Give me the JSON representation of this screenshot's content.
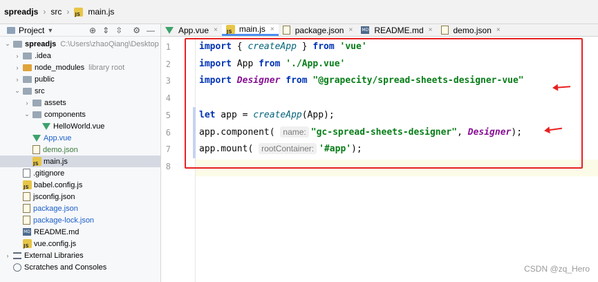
{
  "breadcrumb": {
    "project": "spreadjs",
    "folder": "src",
    "file": "main.js"
  },
  "project_panel": {
    "title": "Project",
    "tree": [
      {
        "label": "spreadjs",
        "path_hint": "C:\\Users\\zhaoQiang\\Desktop",
        "type": "folder",
        "expanded": true,
        "indent": 0
      },
      {
        "label": ".idea",
        "type": "folder",
        "expanded": false,
        "indent": 1
      },
      {
        "label": "node_modules",
        "suffix": "library root",
        "type": "folder-orange",
        "expanded": false,
        "indent": 1
      },
      {
        "label": "public",
        "type": "folder",
        "expanded": false,
        "indent": 1
      },
      {
        "label": "src",
        "type": "folder",
        "expanded": true,
        "indent": 1
      },
      {
        "label": "assets",
        "type": "folder",
        "expanded": false,
        "indent": 2
      },
      {
        "label": "components",
        "type": "folder",
        "expanded": true,
        "indent": 2
      },
      {
        "label": "HelloWorld.vue",
        "type": "vue",
        "indent": 3
      },
      {
        "label": "App.vue",
        "type": "vue",
        "color": "blue",
        "indent": 2
      },
      {
        "label": "demo.json",
        "type": "json",
        "color": "green",
        "indent": 2
      },
      {
        "label": "main.js",
        "type": "js",
        "indent": 2,
        "selected": true
      },
      {
        "label": ".gitignore",
        "type": "file",
        "indent": 1
      },
      {
        "label": "babel.config.js",
        "type": "js",
        "indent": 1
      },
      {
        "label": "jsconfig.json",
        "type": "json",
        "indent": 1
      },
      {
        "label": "package.json",
        "type": "json",
        "color": "blue",
        "indent": 1
      },
      {
        "label": "package-lock.json",
        "type": "json",
        "color": "blue",
        "indent": 1
      },
      {
        "label": "README.md",
        "type": "md",
        "indent": 1
      },
      {
        "label": "vue.config.js",
        "type": "js",
        "indent": 1
      },
      {
        "label": "External Libraries",
        "type": "bars",
        "expanded": false,
        "indent": 0
      },
      {
        "label": "Scratches and Consoles",
        "type": "scratch",
        "indent": 0
      }
    ]
  },
  "tabs": [
    {
      "label": "App.vue",
      "icon": "vue-icon",
      "active": false
    },
    {
      "label": "main.js",
      "icon": "js-icon",
      "active": true
    },
    {
      "label": "package.json",
      "icon": "json-icon",
      "active": false
    },
    {
      "label": "README.md",
      "icon": "md-icon",
      "active": false
    },
    {
      "label": "demo.json",
      "icon": "json-icon",
      "active": false
    }
  ],
  "editor": {
    "line_numbers": [
      "1",
      "2",
      "3",
      "4",
      "5",
      "6",
      "7",
      "8"
    ],
    "lines": [
      [
        {
          "t": "import",
          "c": "kw"
        },
        {
          "t": " { "
        },
        {
          "t": "createApp",
          "c": "fn"
        },
        {
          "t": " } "
        },
        {
          "t": "from",
          "c": "kw"
        },
        {
          "t": " "
        },
        {
          "t": "'vue'",
          "c": "str"
        }
      ],
      [
        {
          "t": "import",
          "c": "kw"
        },
        {
          "t": " App "
        },
        {
          "t": "from",
          "c": "kw"
        },
        {
          "t": " "
        },
        {
          "t": "'./App.vue'",
          "c": "str"
        }
      ],
      [
        {
          "t": "import",
          "c": "kw"
        },
        {
          "t": " "
        },
        {
          "t": "Designer",
          "c": "cls"
        },
        {
          "t": " "
        },
        {
          "t": "from",
          "c": "kw"
        },
        {
          "t": " "
        },
        {
          "t": "\"@grapecity/spread-sheets-designer-vue\"",
          "c": "str"
        }
      ],
      [],
      [
        {
          "t": "let",
          "c": "kw"
        },
        {
          "t": " app = "
        },
        {
          "t": "createApp",
          "c": "fn"
        },
        {
          "t": "(App);"
        }
      ],
      [
        {
          "t": "app.component( "
        },
        {
          "t": "name:",
          "c": "hint"
        },
        {
          "t": "\"gc-spread-sheets-designer\"",
          "c": "str"
        },
        {
          "t": ", "
        },
        {
          "t": "Designer",
          "c": "cls"
        },
        {
          "t": ");"
        }
      ],
      [
        {
          "t": "app.mount( "
        },
        {
          "t": "rootContainer:",
          "c": "hint"
        },
        {
          "t": "'#app'",
          "c": "str"
        },
        {
          "t": ");"
        }
      ],
      []
    ]
  },
  "watermark": "CSDN @zq_Hero",
  "colors": {
    "annotation": "#e82020",
    "keyword": "#0033b3",
    "string": "#067d17",
    "active_tab_underline": "#4a8ef0"
  }
}
